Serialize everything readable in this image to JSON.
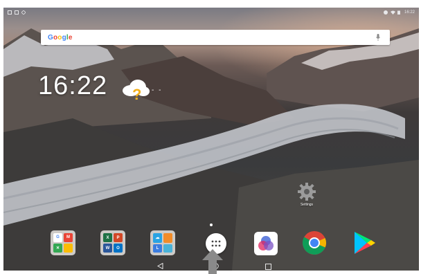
{
  "status_bar": {
    "left_icons": [
      "notification-icon",
      "image-icon",
      "signal-question-icon"
    ],
    "right_icons": [
      "alarm-icon",
      "wifi-icon",
      "battery-icon"
    ],
    "time": "16:22"
  },
  "search": {
    "logo_text": "Google",
    "logo_colors": [
      "#4285F4",
      "#EA4335",
      "#FBBC05",
      "#4285F4",
      "#34A853",
      "#EA4335"
    ]
  },
  "clock": {
    "time": "16:22",
    "weather_text": "- -"
  },
  "settings_shortcut": {
    "label": "Settings"
  },
  "dock": {
    "items": [
      {
        "name": "google-folder",
        "kind": "folder",
        "icon": "google-apps-folder-icon"
      },
      {
        "name": "office-folder",
        "kind": "folder",
        "icon": "office-folder-icon"
      },
      {
        "name": "utilities-folder",
        "kind": "folder",
        "icon": "utilities-folder-icon"
      },
      {
        "name": "app-drawer",
        "kind": "launcher",
        "icon": "app-drawer-icon"
      },
      {
        "name": "photos-app",
        "kind": "app",
        "icon": "color-lens-icon"
      },
      {
        "name": "chrome-app",
        "kind": "app",
        "icon": "chrome-icon"
      },
      {
        "name": "play-store-app",
        "kind": "app",
        "icon": "play-store-icon"
      }
    ]
  },
  "nav": {
    "back_icon": "back-triangle-icon",
    "home_icon": "home-circle-icon",
    "recent_icon": "recent-square-icon"
  },
  "colors": {
    "accent_gold": "#f3b01c",
    "chrome_red": "#db4437",
    "chrome_yellow": "#f4b400",
    "chrome_green": "#0f9d58",
    "chrome_blue": "#4285f4"
  }
}
